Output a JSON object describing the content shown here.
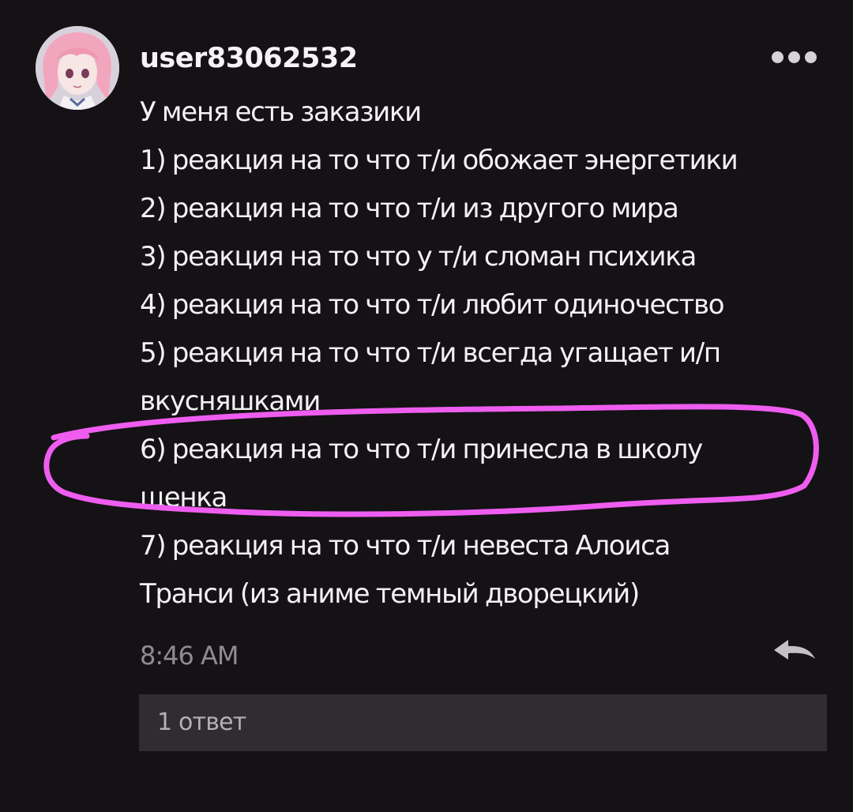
{
  "comment": {
    "username": "user83062532",
    "lines": [
      "У меня есть заказики",
      "1) реакция на то что т/и обожает энергетики",
      "2) реакция на то что т/и из другого мира",
      "3) реакция на то что у т/и сломан психика",
      "4) реакция на то что т/и любит одиночество",
      "5) реакция на то что т/и всегда угащает и/п",
      "вкусняшками",
      "6) реакция на то что т/и принесла в школу",
      "щенка",
      "7) реакция на то что т/и невеста Алоиса",
      "Транси (из аниме темный дворецкий)"
    ],
    "time": "8:46 AM",
    "replies_label": "1 ответ"
  },
  "colors": {
    "background": "#141214",
    "text": "#f4f1f4",
    "muted": "#8f8b8f",
    "reply_bar": "#2f2d2f",
    "highlight": "#ee5df0"
  },
  "icons": {
    "more": "more-horizontal-icon",
    "reply": "reply-arrow-icon"
  }
}
